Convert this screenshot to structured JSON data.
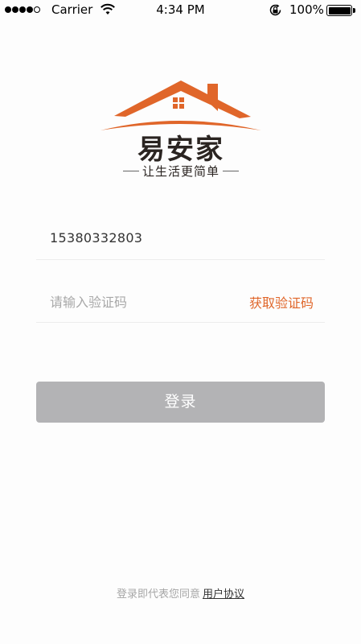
{
  "status_bar": {
    "carrier": "Carrier",
    "time": "4:34 PM",
    "battery": "100%",
    "signal_bars_filled": 4,
    "signal_bars_total": 5,
    "icons": [
      "wifi-icon",
      "orientation-lock-icon",
      "battery-icon"
    ]
  },
  "logo": {
    "brand_name": "易安家",
    "tagline": "让生活更简单",
    "colors": {
      "roof": "#e0662a",
      "text": "#2a2421"
    }
  },
  "form": {
    "phone_value": "15380332803",
    "code_placeholder": "请输入验证码",
    "get_code_label": "获取验证码",
    "login_label": "登录"
  },
  "footer": {
    "agreement_text": "登录即代表您同意",
    "agreement_link": "用户协议"
  },
  "colors": {
    "accent": "#e0662a",
    "button_disabled": "#b3b3b5",
    "divider": "#ececec",
    "placeholder": "#a8a8a8"
  }
}
